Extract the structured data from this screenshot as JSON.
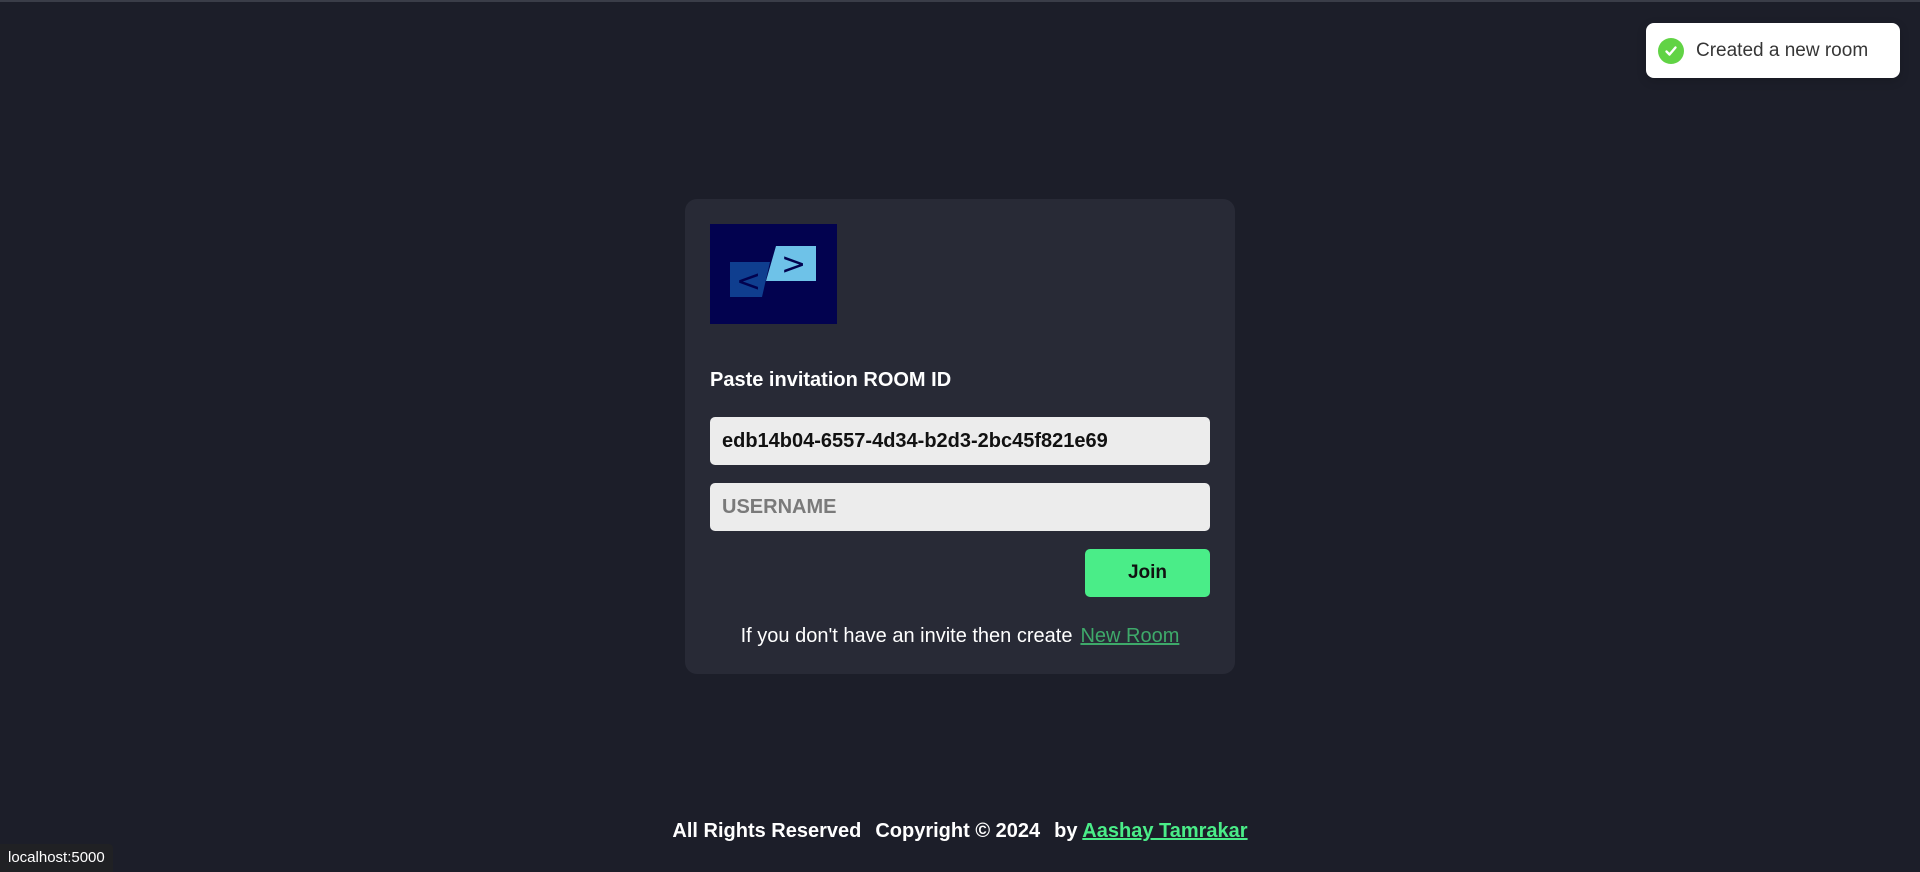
{
  "toast": {
    "icon": "check-circle-icon",
    "message": "Created a new room",
    "color": "#61d345"
  },
  "card": {
    "logo_icon": "code-brackets-logo",
    "label": "Paste invitation ROOM ID",
    "room_id_value": "edb14b04-6557-4d34-b2d3-2bc45f821e69",
    "username_placeholder": "USERNAME",
    "join_label": "Join",
    "info_text": "If you don't have an invite then create",
    "new_room_link": "New Room"
  },
  "footer": {
    "rights": "All Rights Reserved",
    "copyright": "Copyright © 2024",
    "by": "by",
    "author": "Aashay Tamrakar"
  },
  "status_bar": {
    "url": "localhost:5000"
  },
  "colors": {
    "background": "#1c1e29",
    "card": "#282a36",
    "accent": "#4aed88"
  }
}
